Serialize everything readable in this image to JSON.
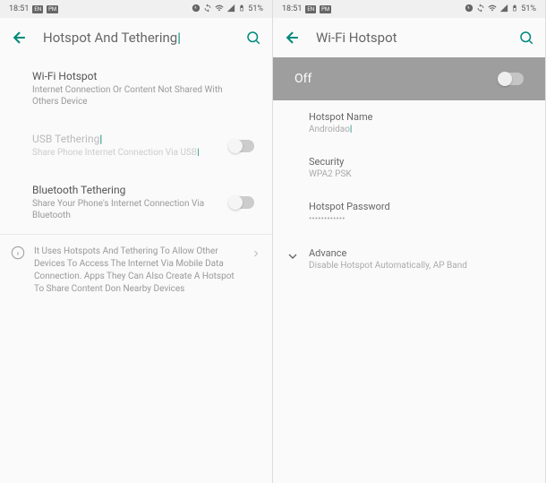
{
  "statusBar": {
    "time": "18:51",
    "badge1": "EN",
    "badge2": "PM",
    "battery": "51%"
  },
  "left": {
    "title": "Hotspot And Tethering",
    "wifiHotspot": {
      "title": "Wi-Fi Hotspot",
      "subtitle": "Internet Connection Or Content Not Shared With Others Device"
    },
    "usbTethering": {
      "title": "USB Tethering",
      "subtitle": "Share Phone Internet Connection Via USB"
    },
    "bluetoothTethering": {
      "title": "Bluetooth Tethering",
      "subtitle": "Share Your Phone's Internet Connection Via Bluetooth"
    },
    "info": "It Uses Hotspots And Tethering To Allow Other Devices To Access The Internet Via Mobile Data Connection. Apps They Can Also Create A Hotspot To Share Content Don Nearby Devices"
  },
  "right": {
    "title": "Wi-Fi Hotspot",
    "banner": "Off",
    "hotspotName": {
      "label": "Hotspot Name",
      "value": "Androidao"
    },
    "security": {
      "label": "Security",
      "value": "WPA2 PSK"
    },
    "password": {
      "label": "Hotspot Password",
      "value": "••••••••••••"
    },
    "advance": {
      "label": "Advance",
      "value": "Disable Hotspot Automatically, AP Band"
    }
  }
}
